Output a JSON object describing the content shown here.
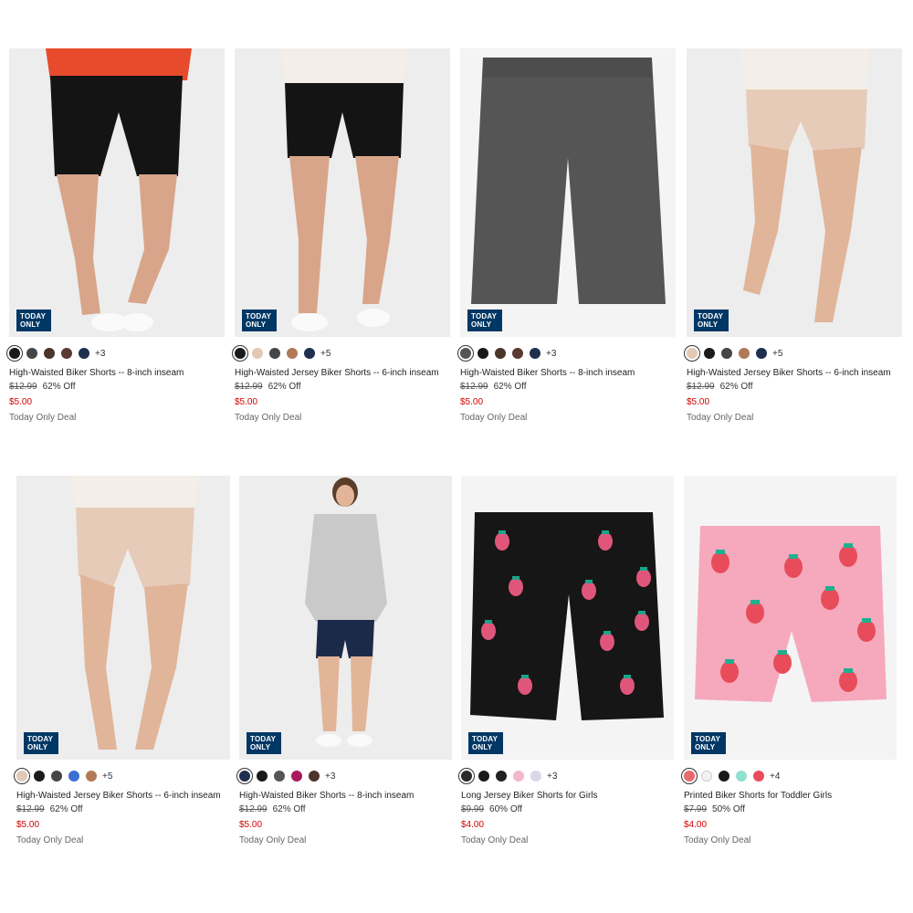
{
  "products": [
    {
      "name": "High-Waisted Biker Shorts -- 8-inch inseam",
      "badge": "TODAY ONLY",
      "swatches": [
        "#1a1a1a",
        "#444648",
        "#4b342a",
        "#5a3a31",
        "#1f2f4e"
      ],
      "more": "+3",
      "original_price": "$12.99",
      "discount": "62% Off",
      "price": "$5.00",
      "deal": "Today Only Deal"
    },
    {
      "name": "High-Waisted Jersey Biker Shorts -- 6-inch inseam",
      "badge": "TODAY ONLY",
      "swatches": [
        "#1a1a1a",
        "#e3c8b4",
        "#444648",
        "#b07a58",
        "#1f2f4e"
      ],
      "more": "+5",
      "original_price": "$12.99",
      "discount": "62% Off",
      "price": "$5.00",
      "deal": "Today Only Deal"
    },
    {
      "name": "High-Waisted Biker Shorts -- 8-inch inseam",
      "badge": "TODAY ONLY",
      "swatches": [
        "#555555",
        "#1a1a1a",
        "#4b342a",
        "#5a3a31",
        "#1f2f4e"
      ],
      "more": "+3",
      "original_price": "$12.99",
      "discount": "62% Off",
      "price": "$5.00",
      "deal": "Today Only Deal"
    },
    {
      "name": "High-Waisted Jersey Biker Shorts -- 6-inch inseam",
      "badge": "TODAY ONLY",
      "swatches": [
        "#e3c8b4",
        "#1a1a1a",
        "#444648",
        "#b07a58",
        "#1f2f4e"
      ],
      "more": "+5",
      "original_price": "$12.99",
      "discount": "62% Off",
      "price": "$5.00",
      "deal": "Today Only Deal"
    },
    {
      "name": "High-Waisted Jersey Biker Shorts -- 6-inch inseam",
      "badge": "TODAY ONLY",
      "swatches": [
        "#e3c8b4",
        "#1a1a1a",
        "#444648",
        "#3b6fd1",
        "#b07a58"
      ],
      "more": "+5",
      "original_price": "$12.99",
      "discount": "62% Off",
      "price": "$5.00",
      "deal": "Today Only Deal"
    },
    {
      "name": "High-Waisted Biker Shorts -- 8-inch inseam",
      "badge": "TODAY ONLY",
      "swatches": [
        "#1f2f4e",
        "#1a1a1a",
        "#555555",
        "#a81b5d",
        "#4b342a"
      ],
      "more": "+3",
      "original_price": "$12.99",
      "discount": "62% Off",
      "price": "$5.00",
      "deal": "Today Only Deal"
    },
    {
      "name": "Long Jersey Biker Shorts for Girls",
      "badge": "TODAY ONLY",
      "swatches": [
        "#2b2b2b",
        "#1a1a1a",
        "#222222",
        "#f4b7c8",
        "#d8d8e8"
      ],
      "more": "+3",
      "original_price": "$9.99",
      "discount": "60% Off",
      "price": "$4.00",
      "deal": "Today Only Deal"
    },
    {
      "name": "Printed Biker Shorts for Toddler Girls",
      "badge": "TODAY ONLY",
      "swatches": [
        "#e86a6a",
        "#f3f3f3",
        "#1a1a1a",
        "#8ee0cf",
        "#e84c5a"
      ],
      "more": "+4",
      "original_price": "$7.99",
      "discount": "50% Off",
      "price": "$4.00",
      "deal": "Today Only Deal"
    }
  ]
}
